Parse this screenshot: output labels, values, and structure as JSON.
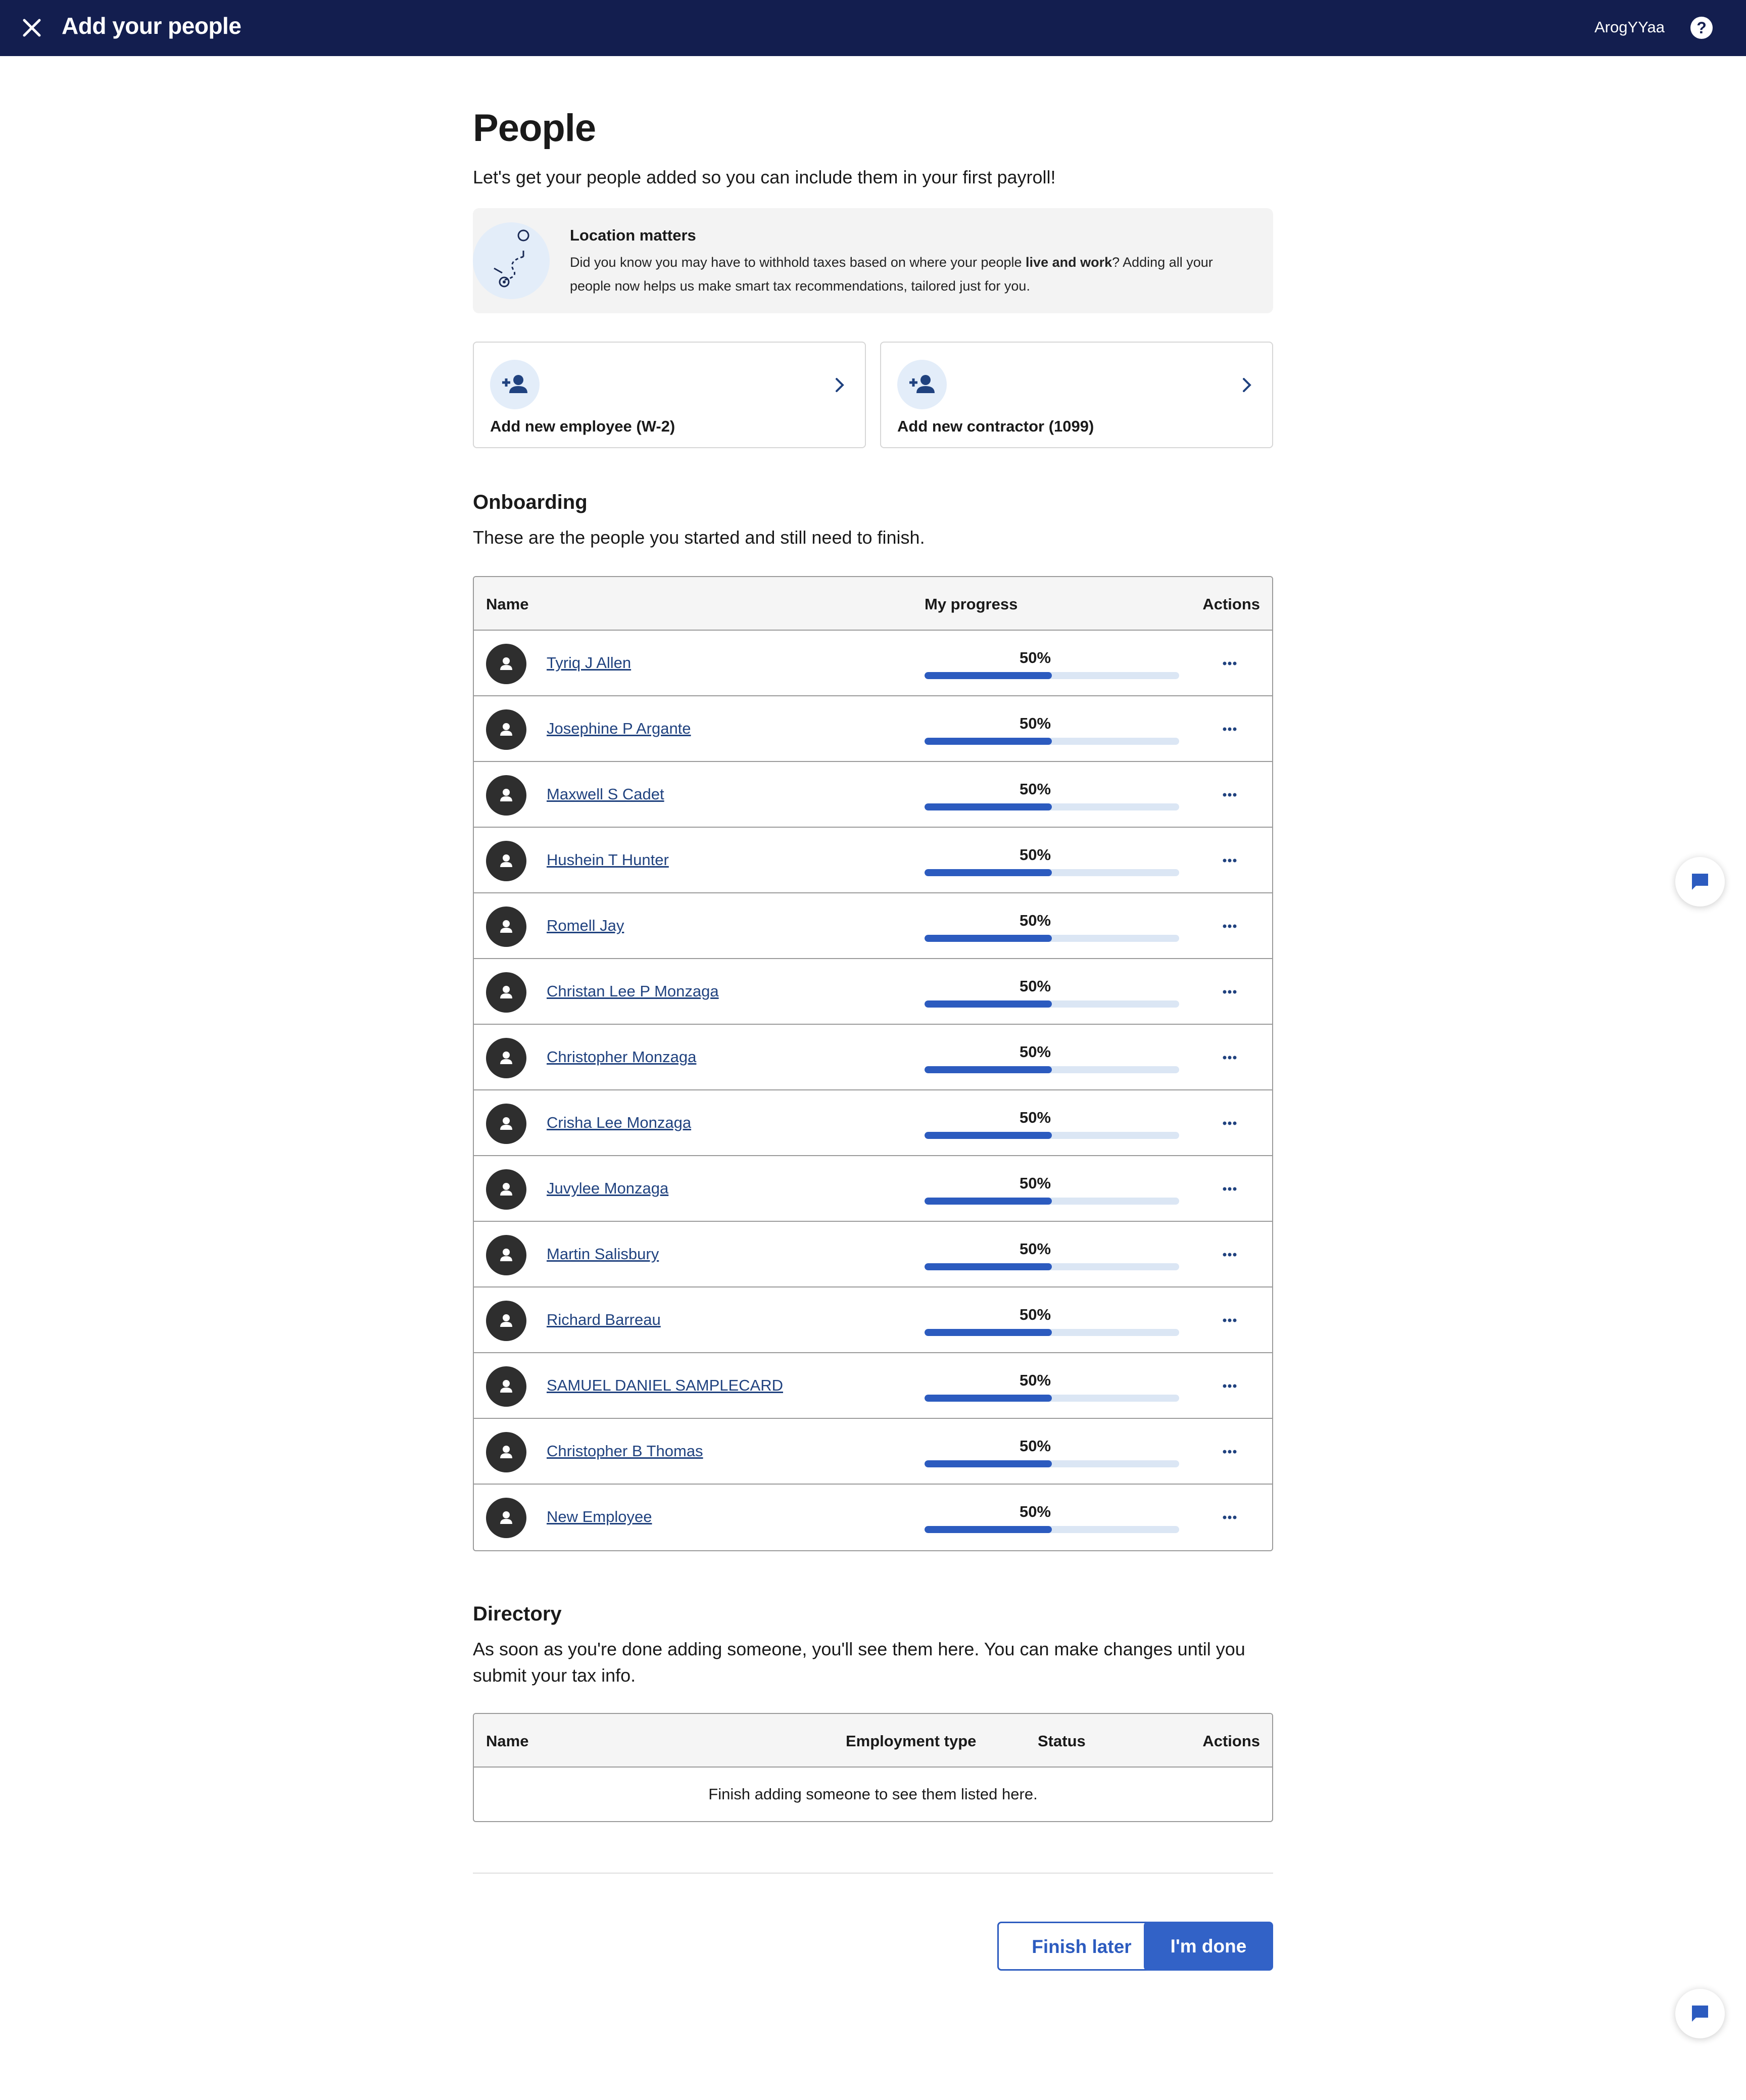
{
  "topbar": {
    "title": "Add your people",
    "user": "ArogYYaa",
    "help_glyph": "?",
    "close_icon": "close-icon",
    "background_color": "#131e4f"
  },
  "header": {
    "title": "People",
    "subtitle": "Let's get your people added so you can include them in your first payroll!"
  },
  "info_banner": {
    "title": "Location matters",
    "body_before": "Did you know you may have to withhold taxes based on where your people ",
    "body_bold": "live and work",
    "body_after": "? Adding all your people now helps us make smart tax recommendations, tailored just for you."
  },
  "add_cards": [
    {
      "label": "Add new employee (W-2)",
      "icon": "add-person-icon"
    },
    {
      "label": "Add new contractor (1099)",
      "icon": "add-person-icon"
    }
  ],
  "onboarding": {
    "title": "Onboarding",
    "subtitle": "These are the people you started and still need to finish.",
    "columns": {
      "name": "Name",
      "progress": "My progress",
      "actions": "Actions"
    },
    "rows": [
      {
        "name": "Tyriq J Allen",
        "progress_label": "50%",
        "progress": 0.5
      },
      {
        "name": "Josephine P Argante",
        "progress_label": "50%",
        "progress": 0.5
      },
      {
        "name": "Maxwell S Cadet",
        "progress_label": "50%",
        "progress": 0.5
      },
      {
        "name": "Hushein T Hunter",
        "progress_label": "50%",
        "progress": 0.5
      },
      {
        "name": "Romell Jay",
        "progress_label": "50%",
        "progress": 0.5
      },
      {
        "name": "Christan Lee P Monzaga",
        "progress_label": "50%",
        "progress": 0.5
      },
      {
        "name": "Christopher Monzaga",
        "progress_label": "50%",
        "progress": 0.5
      },
      {
        "name": "Crisha Lee Monzaga",
        "progress_label": "50%",
        "progress": 0.5
      },
      {
        "name": "Juvylee Monzaga",
        "progress_label": "50%",
        "progress": 0.5
      },
      {
        "name": "Martin Salisbury",
        "progress_label": "50%",
        "progress": 0.5
      },
      {
        "name": "Richard Barreau",
        "progress_label": "50%",
        "progress": 0.5
      },
      {
        "name": "SAMUEL DANIEL SAMPLECARD",
        "progress_label": "50%",
        "progress": 0.5
      },
      {
        "name": "Christopher B Thomas",
        "progress_label": "50%",
        "progress": 0.5
      },
      {
        "name": "New Employee",
        "progress_label": "50%",
        "progress": 0.5
      }
    ]
  },
  "directory": {
    "title": "Directory",
    "subtitle": "As soon as you're done adding someone, you'll see them here. You can make changes until you submit your tax info.",
    "columns": {
      "name": "Name",
      "employment_type": "Employment type",
      "status": "Status",
      "actions": "Actions"
    },
    "empty_text": "Finish adding someone to see them listed here."
  },
  "footer": {
    "finish_later": "Finish later",
    "done": "I'm done"
  },
  "colors": {
    "accent": "#3262c7",
    "link": "#20427f",
    "progress_track": "#dbe6f4"
  },
  "chat_icon": "chat-bubble-icon"
}
